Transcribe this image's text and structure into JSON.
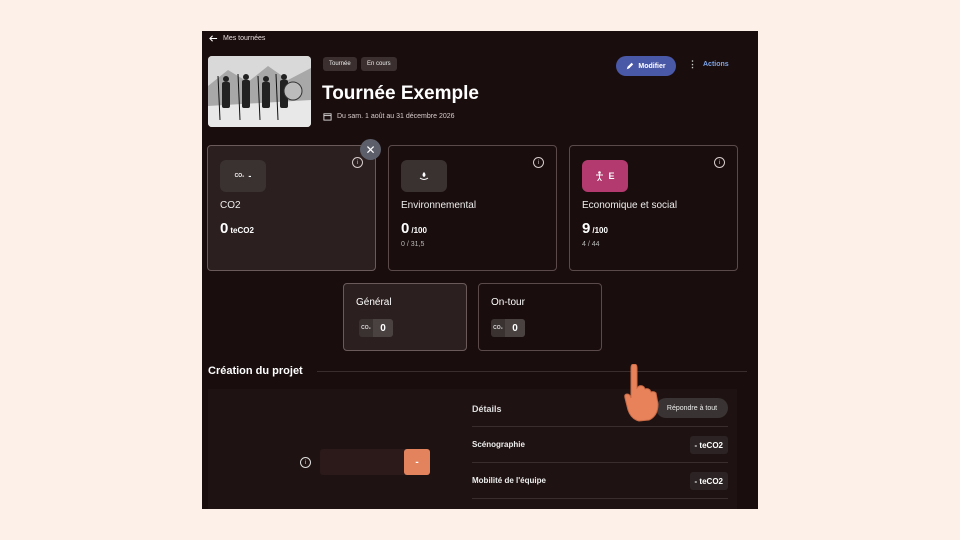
{
  "nav": {
    "back_label": "Mes tournées"
  },
  "header": {
    "tags": [
      "Tournée",
      "En cours"
    ],
    "title": "Tournée Exemple",
    "dates": "Du sam. 1 août au 31 décembre 2026",
    "modify_label": "Modifier",
    "actions_label": "Actions"
  },
  "cards": [
    {
      "icon": "co2-icon",
      "icon_text": "-",
      "label": "CO2",
      "value": "0",
      "unit": "teCO2",
      "sub": ""
    },
    {
      "icon": "leaf-hand-icon",
      "icon_text": "",
      "label": "Environnemental",
      "value": "0",
      "unit": "/100",
      "sub": "0 / 31,5"
    },
    {
      "icon": "person-icon",
      "icon_text": "E",
      "label": "Economique et social",
      "value": "9",
      "unit": "/100",
      "sub": "4 / 44"
    }
  ],
  "subcards": [
    {
      "label": "Général",
      "value": "0"
    },
    {
      "label": "On-tour",
      "value": "0"
    }
  ],
  "section": {
    "title": "Création du projet"
  },
  "details": {
    "title": "Détails",
    "reply_all": "Répondre à tout",
    "rows": [
      {
        "label": "Scénographie",
        "value": "- teCO2"
      },
      {
        "label": "Mobilité de l'équipe",
        "value": "- teCO2"
      }
    ]
  },
  "input": {
    "button_label": "-"
  },
  "colors": {
    "accent": "#4a58a8",
    "link": "#7ba3e8",
    "badge_e": "#b23a6e",
    "orange": "#e3835e"
  }
}
